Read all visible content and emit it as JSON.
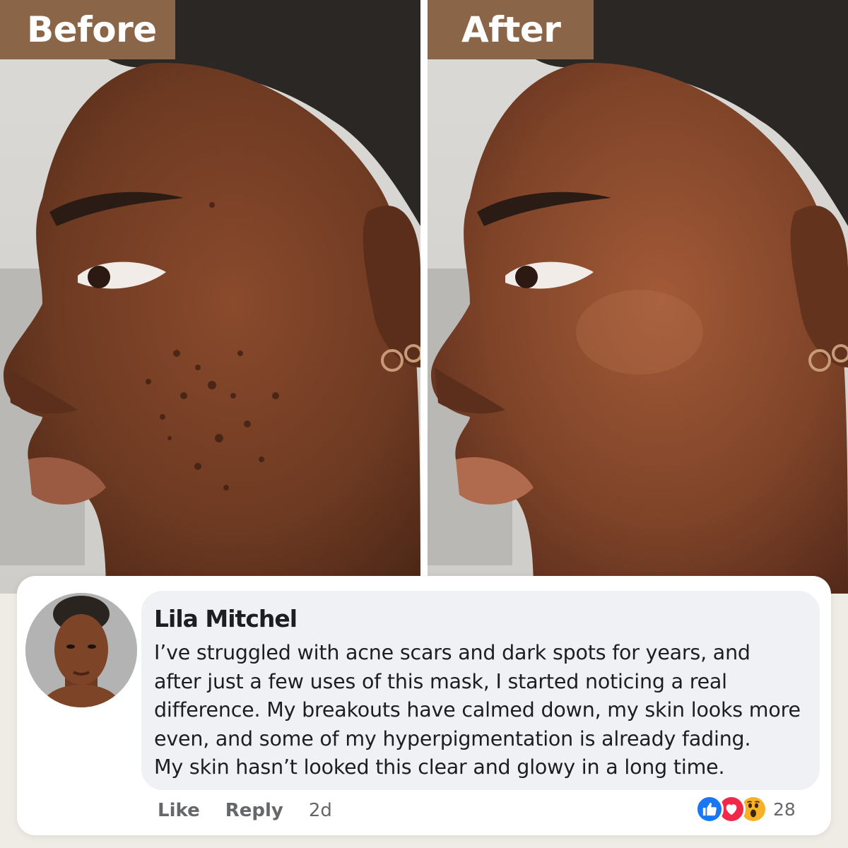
{
  "panels": {
    "before": {
      "label": "Before"
    },
    "after": {
      "label": "After"
    }
  },
  "comment": {
    "author": "Lila Mitchel",
    "lines": [
      "I’ve struggled with acne scars and dark spots for years, and",
      "after just a few uses of this mask, I started noticing a real",
      "difference. My breakouts have calmed down, my skin looks more",
      "even, and some of my hyperpigmentation is already fading.",
      "My skin hasn’t looked this clear and glowy in a long time."
    ],
    "actions": {
      "like_label": "Like",
      "reply_label": "Reply",
      "timestamp": "2d"
    },
    "reactions": {
      "icons": [
        "like-icon",
        "love-icon",
        "wow-icon"
      ],
      "count": "28"
    }
  },
  "colors": {
    "label_tag": "#8b6548",
    "bubble": "#eff1f4",
    "like": "#1877f2",
    "love": "#f02849",
    "wow": "#f7b125",
    "muted_text": "#65676b"
  }
}
